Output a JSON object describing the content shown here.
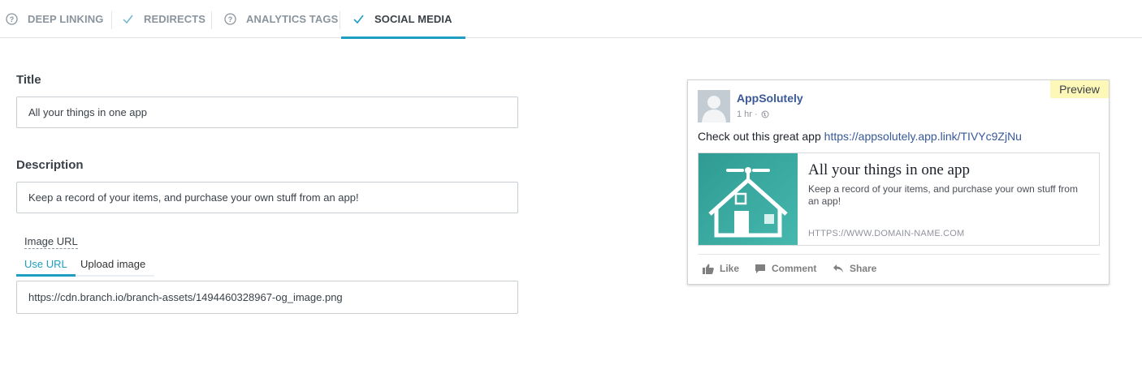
{
  "tabs": [
    {
      "label": "DEEP LINKING",
      "icon": "help-circle-icon",
      "state": "inactive"
    },
    {
      "label": "REDIRECTS",
      "icon": "check-icon",
      "state": "inactive"
    },
    {
      "label": "ANALYTICS TAGS",
      "icon": "help-circle-icon",
      "state": "inactive"
    },
    {
      "label": "SOCIAL MEDIA",
      "icon": "check-icon",
      "state": "active"
    }
  ],
  "form": {
    "title_label": "Title",
    "title_value": "All your things in one app",
    "description_label": "Description",
    "description_value": "Keep a record of your items, and purchase your own stuff from an app!",
    "image_url_label": "Image URL",
    "image_tabs": [
      {
        "label": "Use URL",
        "state": "active"
      },
      {
        "label": "Upload image",
        "state": "inactive"
      }
    ],
    "image_url_value": "https://cdn.branch.io/branch-assets/1494460328967-og_image.png"
  },
  "preview": {
    "badge": "Preview",
    "page_name": "AppSolutely",
    "time": "1 hr ·",
    "post_text": "Check out this great app",
    "post_link": "https://appsolutely.app.link/TIVYc9ZjNu",
    "card_title": "All your things in one app",
    "card_description": "Keep a record of your items, and purchase your own stuff from an app!",
    "card_domain": "HTTPS://WWW.DOMAIN-NAME.COM",
    "actions": [
      "Like",
      "Comment",
      "Share"
    ]
  },
  "colors": {
    "accent": "#1e9ec1",
    "facebook_blue": "#3b5998",
    "preview_badge": "#fdf8b8",
    "thumbnail_teal": "#3aa79d"
  }
}
